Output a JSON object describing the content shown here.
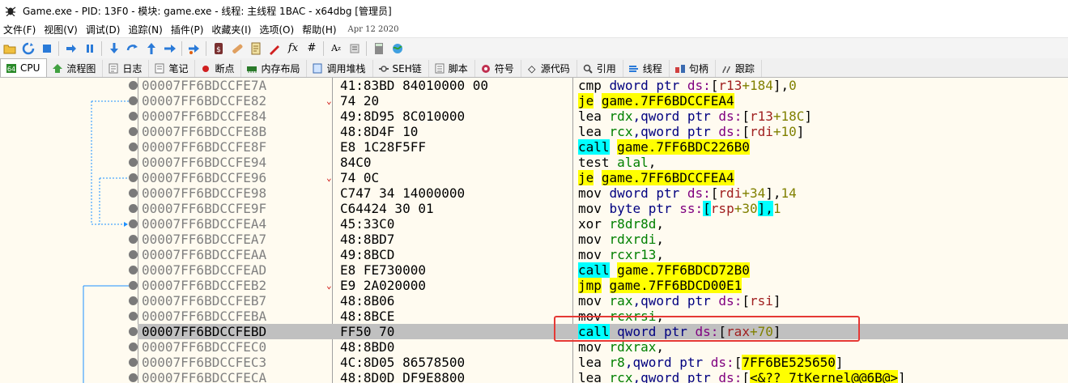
{
  "window": {
    "title": "Game.exe - PID: 13F0 - 模块: game.exe - 线程: 主线程 1BAC - x64dbg [管理员]"
  },
  "menu": {
    "items": [
      "文件(F)",
      "视图(V)",
      "调试(D)",
      "追踪(N)",
      "插件(P)",
      "收藏夹(I)",
      "选项(O)",
      "帮助(H)"
    ],
    "date": "Apr 12 2020"
  },
  "toolbar": {
    "icons": [
      "open-icon",
      "restart-icon",
      "stop-icon",
      "run-icon",
      "pause-icon",
      "step-into-icon",
      "step-over-icon",
      "trace-into-icon",
      "run-to-user-icon",
      "execute-till-return-icon",
      "run-to-cursor-icon",
      "scylla-icon",
      "patch-icon",
      "script-icon",
      "fx-icon",
      "hash-icon",
      "font-icon",
      "strings-icon",
      "calculator-icon",
      "globe-icon"
    ],
    "fx_label": "fx",
    "hash_label": "#"
  },
  "tabs": [
    {
      "label": "CPU",
      "icon": "cpu-icon",
      "active": true
    },
    {
      "label": "流程图",
      "icon": "graph-icon"
    },
    {
      "label": "日志",
      "icon": "log-icon"
    },
    {
      "label": "笔记",
      "icon": "notes-icon"
    },
    {
      "label": "断点",
      "icon": "breakpoint-icon"
    },
    {
      "label": "内存布局",
      "icon": "memory-icon"
    },
    {
      "label": "调用堆栈",
      "icon": "callstack-icon"
    },
    {
      "label": "SEH链",
      "icon": "seh-icon"
    },
    {
      "label": "脚本",
      "icon": "script-icon"
    },
    {
      "label": "符号",
      "icon": "symbols-icon"
    },
    {
      "label": "源代码",
      "icon": "source-icon"
    },
    {
      "label": "引用",
      "icon": "references-icon"
    },
    {
      "label": "线程",
      "icon": "threads-icon"
    },
    {
      "label": "句柄",
      "icon": "handles-icon"
    },
    {
      "label": "跟踪",
      "icon": "trace-icon"
    }
  ],
  "disasm": {
    "rows": [
      {
        "addr": "00007FF6BDCCFE7A",
        "bytes": "41:83BD 84010000 00",
        "mark": ""
      },
      {
        "addr": "00007FF6BDCCFE82",
        "bytes": "74 20",
        "mark": "⌄"
      },
      {
        "addr": "00007FF6BDCCFE84",
        "bytes": "49:8D95 8C010000",
        "mark": ""
      },
      {
        "addr": "00007FF6BDCCFE8B",
        "bytes": "48:8D4F 10",
        "mark": ""
      },
      {
        "addr": "00007FF6BDCCFE8F",
        "bytes": "E8 1C28F5FF",
        "mark": ""
      },
      {
        "addr": "00007FF6BDCCFE94",
        "bytes": "84C0",
        "mark": ""
      },
      {
        "addr": "00007FF6BDCCFE96",
        "bytes": "74 0C",
        "mark": "⌄"
      },
      {
        "addr": "00007FF6BDCCFE98",
        "bytes": "C747 34 14000000",
        "mark": ""
      },
      {
        "addr": "00007FF6BDCCFE9F",
        "bytes": "C64424 30 01",
        "mark": ""
      },
      {
        "addr": "00007FF6BDCCFEA4",
        "bytes": "45:33C0",
        "mark": ""
      },
      {
        "addr": "00007FF6BDCCFEA7",
        "bytes": "48:8BD7",
        "mark": ""
      },
      {
        "addr": "00007FF6BDCCFEAA",
        "bytes": "49:8BCD",
        "mark": ""
      },
      {
        "addr": "00007FF6BDCCFEAD",
        "bytes": "E8 FE730000",
        "mark": ""
      },
      {
        "addr": "00007FF6BDCCFEB2",
        "bytes": "E9 2A020000",
        "mark": "⌄"
      },
      {
        "addr": "00007FF6BDCCFEB7",
        "bytes": "48:8B06",
        "mark": ""
      },
      {
        "addr": "00007FF6BDCCFEBA",
        "bytes": "48:8BCE",
        "mark": ""
      },
      {
        "addr": "00007FF6BDCCFEBD",
        "bytes": "FF50 70",
        "mark": "",
        "selected": true
      },
      {
        "addr": "00007FF6BDCCFEC0",
        "bytes": "48:8BD0",
        "mark": ""
      },
      {
        "addr": "00007FF6BDCCFEC3",
        "bytes": "4C:8D05 86578500",
        "mark": ""
      },
      {
        "addr": "00007FF6BDCCFECA",
        "bytes": "48:8D0D DF9E8800",
        "mark": ""
      }
    ],
    "instr": {
      "r0": {
        "m": "cmp",
        "a": "dword ptr ",
        "s": "ds:",
        "o": "[",
        "r": "r13",
        "p": "+184",
        "c": "],",
        "n": "0"
      },
      "r1": {
        "m": "je",
        "t": "game.7FF6BDCCFEA4"
      },
      "r2": {
        "m": "lea",
        "r1": "rdx",
        "a": ",qword ptr ",
        "s": "ds:",
        "o": "[",
        "r2": "r13",
        "p": "+18C",
        "c": "]"
      },
      "r3": {
        "m": "lea",
        "r1": "rcx",
        "a": ",qword ptr ",
        "s": "ds:",
        "o": "[",
        "r2": "rdi",
        "p": "+10",
        "c": "]"
      },
      "r4": {
        "m": "call",
        "t": "game.7FF6BDC226B0"
      },
      "r5": {
        "m": "test",
        "r1": "al",
        "c": ",",
        "r2": "al"
      },
      "r6": {
        "m": "je",
        "t": "game.7FF6BDCCFEA4"
      },
      "r7": {
        "m": "mov",
        "a": "dword ptr ",
        "s": "ds:",
        "o": "[",
        "r": "rdi",
        "p": "+34",
        "c": "],",
        "n": "14"
      },
      "r8": {
        "m": "mov",
        "a": "byte ptr ",
        "s": "ss:",
        "o": "[",
        "r": "rsp",
        "p": "+30",
        "c": "],",
        "n": "1"
      },
      "r9": {
        "m": "xor",
        "r1": "r8d",
        "c": ",",
        "r2": "r8d"
      },
      "r10": {
        "m": "mov",
        "r1": "rdx",
        "c": ",",
        "r2": "rdi"
      },
      "r11": {
        "m": "mov",
        "r1": "rcx",
        "c": ",",
        "r2": "r13"
      },
      "r12": {
        "m": "call",
        "t": "game.7FF6BDCD72B0"
      },
      "r13": {
        "m": "jmp",
        "t": "game.7FF6BDCD00E1"
      },
      "r14": {
        "m": "mov",
        "r1": "rax",
        "a": ",qword ptr ",
        "s": "ds:",
        "o": "[",
        "r2": "rsi",
        "c": "]"
      },
      "r15": {
        "m": "mov",
        "r1": "rcx",
        "c": ",",
        "r2": "rsi"
      },
      "r16": {
        "m": "call",
        "a": "qword ptr ",
        "s": "ds:",
        "o": "[",
        "r": "rax",
        "p": "+70",
        "c": "]"
      },
      "r17": {
        "m": "mov",
        "r1": "rdx",
        "c": ",",
        "r2": "rax"
      },
      "r18": {
        "m": "lea",
        "r1": "r8",
        "a": ",qword ptr ",
        "s": "ds:",
        "o": "[",
        "t": "7FF6BE525650",
        "c": "]"
      },
      "r19": {
        "m": "lea",
        "r1": "rcx",
        "a": ",qword ptr ",
        "s": "ds:",
        "o": "[",
        "t": "<&??_7tKernel@@6B@>",
        "c": "]"
      }
    }
  },
  "colors": {
    "background": "#fffbf0",
    "selected_row": "#c0c0c0",
    "jump_highlight": "#ffff00",
    "call_highlight": "#00ffff",
    "annotation_box": "#e53935",
    "branch_line": "#1e90ff"
  }
}
